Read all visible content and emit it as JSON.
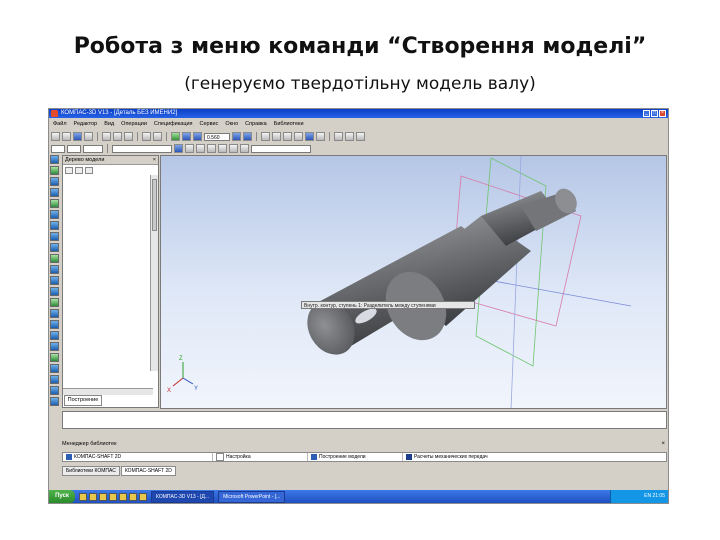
{
  "slide": {
    "title": "Робота з меню команди “Створення моделі”",
    "subtitle": "(генеруємо твердотільну модель валу)"
  },
  "app": {
    "window_title": "КОМПАС-3D V13 - [Деталь БЕЗ ИМЕНИ2]",
    "menu": [
      "Файл",
      "Редактор",
      "Вид",
      "Операции",
      "Спецификация",
      "Сервис",
      "Окно",
      "Справка",
      "Библиотеки"
    ],
    "zoom_value": "0.560"
  },
  "model_tree": {
    "title": "Дерево модели",
    "close_label": "×",
    "tab_label": "Построение"
  },
  "viewport": {
    "tooltip": "Внутр. контур, ступень 1: Разделитель между ступенями"
  },
  "axes": {
    "x": "X",
    "y": "Y",
    "z": "Z"
  },
  "library_manager": {
    "title": "Менеджер библиотек",
    "close_label": "×",
    "row": [
      "КОМПАС-SHAFT 2D",
      "Настройка",
      "Построение модели",
      "Расчеты механических передач"
    ],
    "tabs": [
      "Библиотеки КОМПАС",
      "КОМПАС-SHAFT 2D"
    ]
  },
  "taskbar": {
    "start_label": "Пуск",
    "tasks": [
      "КОМПАС-3D V13 - [Д...",
      "Microsoft PowerPoint - [..."
    ],
    "clock": "21:05",
    "lang": "EN"
  },
  "colors": {
    "accent": "#0a3fc7",
    "viewport_bg": "#dfe8f7",
    "model_grey": "#6f7175"
  }
}
